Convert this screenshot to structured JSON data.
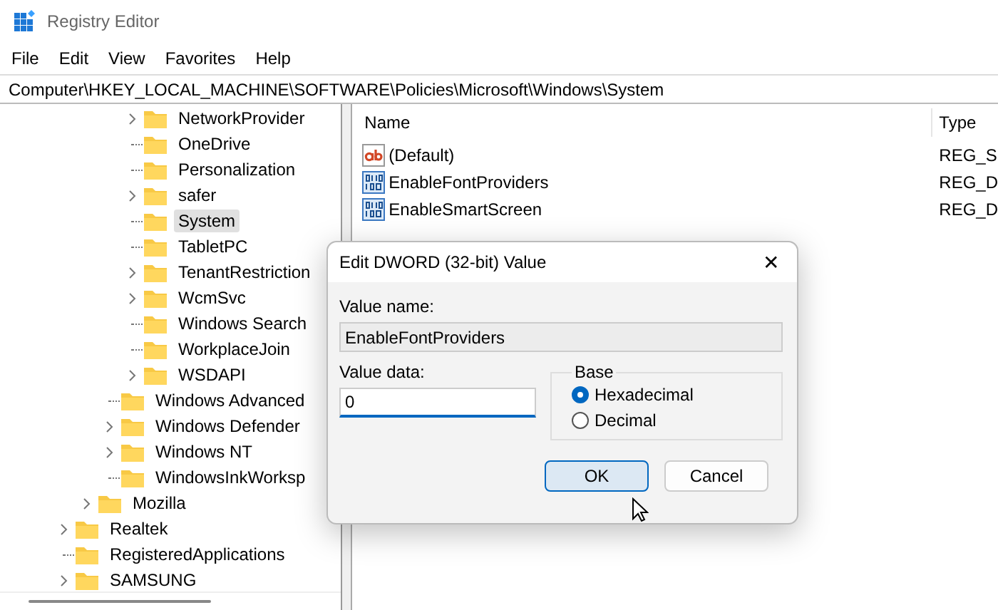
{
  "window": {
    "title": "Registry Editor"
  },
  "menu": [
    "File",
    "Edit",
    "View",
    "Favorites",
    "Help"
  ],
  "address": "Computer\\HKEY_LOCAL_MACHINE\\SOFTWARE\\Policies\\Microsoft\\Windows\\System",
  "tree": {
    "items": [
      {
        "children": [
          {
            "children": [
              {
                "children": [
                  {
                    "children": [
                      {
                        "label": "NetworkProvider",
                        "expandable": true,
                        "selected": false
                      },
                      {
                        "label": "OneDrive",
                        "expandable": false,
                        "selected": false
                      },
                      {
                        "label": "Personalization",
                        "expandable": false,
                        "selected": false
                      },
                      {
                        "label": "safer",
                        "expandable": true,
                        "selected": false
                      },
                      {
                        "label": "System",
                        "expandable": false,
                        "selected": true
                      },
                      {
                        "label": "TabletPC",
                        "expandable": false,
                        "selected": false
                      },
                      {
                        "label": "TenantRestriction",
                        "expandable": true,
                        "selected": false
                      },
                      {
                        "label": "WcmSvc",
                        "expandable": true,
                        "selected": false
                      },
                      {
                        "label": "Windows Search",
                        "expandable": false,
                        "selected": false
                      },
                      {
                        "label": "WorkplaceJoin",
                        "expandable": false,
                        "selected": false
                      },
                      {
                        "label": "WSDAPI",
                        "expandable": true,
                        "selected": false
                      }
                    ]
                  },
                  {
                    "label": "Windows Advanced",
                    "expandable": false,
                    "selected": false
                  },
                  {
                    "label": "Windows Defender",
                    "expandable": true,
                    "selected": false
                  },
                  {
                    "label": "Windows NT",
                    "expandable": true,
                    "selected": false
                  },
                  {
                    "label": "WindowsInkWorksp",
                    "expandable": false,
                    "selected": false
                  }
                ]
              },
              {
                "label": "Mozilla",
                "expandable": true,
                "selected": false
              }
            ]
          },
          {
            "label": "Realtek",
            "expandable": true,
            "selected": false
          },
          {
            "label": "RegisteredApplications",
            "expandable": false,
            "selected": false
          },
          {
            "label": "SAMSUNG",
            "expandable": true,
            "selected": false
          }
        ]
      }
    ]
  },
  "values": {
    "columns": [
      "Name",
      "Type"
    ],
    "rows": [
      {
        "kind": "string",
        "name": "(Default)",
        "type": "REG_S"
      },
      {
        "kind": "dword",
        "name": "EnableFontProviders",
        "type": "REG_D"
      },
      {
        "kind": "dword",
        "name": "EnableSmartScreen",
        "type": "REG_D"
      }
    ]
  },
  "dialog": {
    "title": "Edit DWORD (32-bit) Value",
    "close": "✕",
    "value_name_label": "Value name:",
    "value_name": "EnableFontProviders",
    "value_data_label": "Value data:",
    "value_data": "0",
    "base": {
      "label": "Base",
      "options": [
        {
          "label": "Hexadecimal",
          "selected": true
        },
        {
          "label": "Decimal",
          "selected": false
        }
      ]
    },
    "buttons": [
      {
        "label": "OK",
        "default": true
      },
      {
        "label": "Cancel",
        "default": false
      }
    ]
  }
}
